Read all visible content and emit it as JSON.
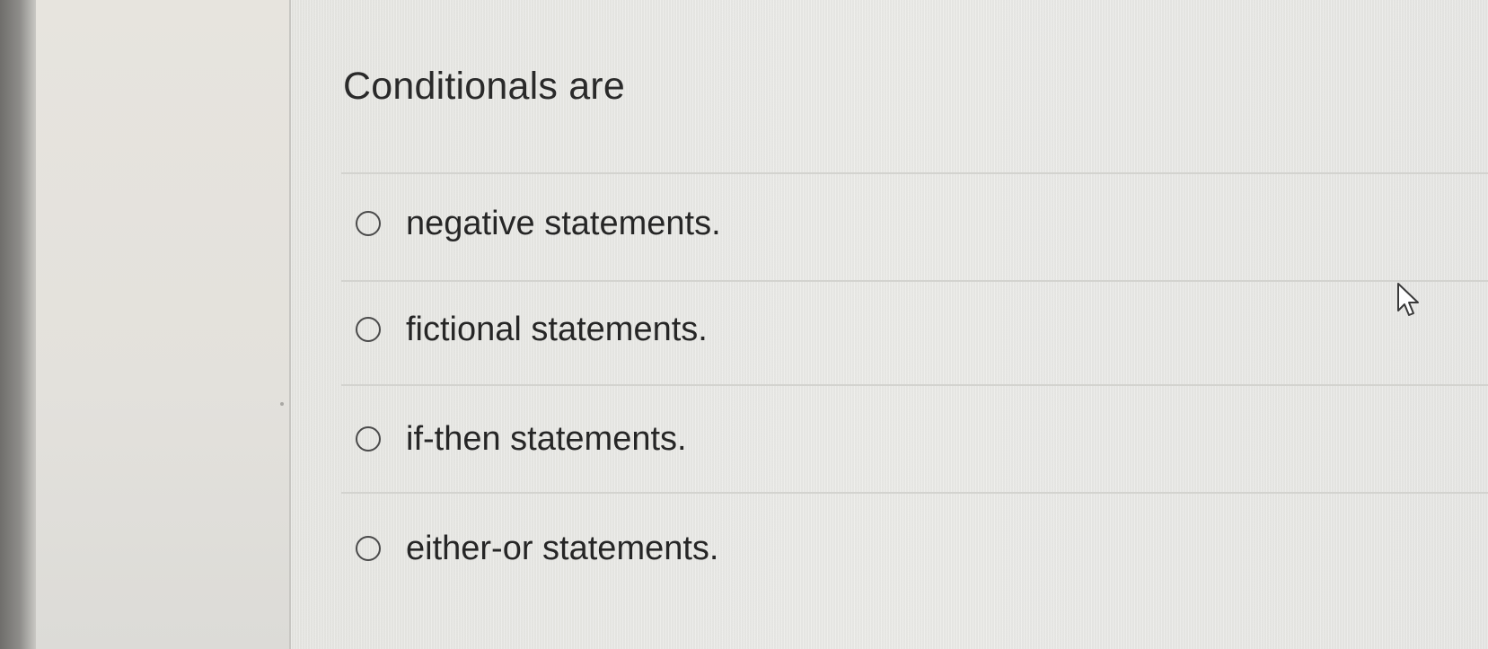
{
  "quiz": {
    "question": "Conditionals are",
    "options": [
      {
        "label": "negative statements.",
        "selected": false
      },
      {
        "label": "fictional statements.",
        "selected": false
      },
      {
        "label": "if-then statements.",
        "selected": false
      },
      {
        "label": "either-or statements.",
        "selected": false
      }
    ]
  },
  "cursor": {
    "icon": "mouse-pointer-icon"
  },
  "colors": {
    "page_background": "#e4e3df",
    "content_background": "#e8e8e5",
    "text": "#2a2a2a",
    "radio_border": "#4a4a4a",
    "divider": "#d3d3cf"
  }
}
